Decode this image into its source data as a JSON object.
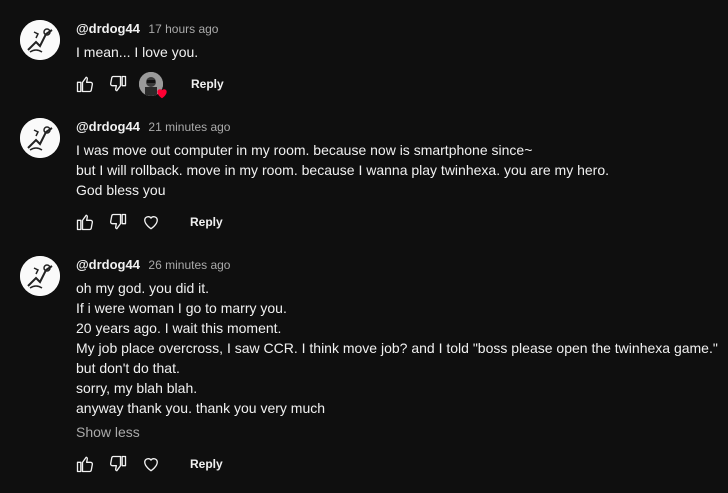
{
  "comments": [
    {
      "author": "@drdog44",
      "time": "17 hours ago",
      "lines": [
        "I mean... I love you."
      ],
      "reply_label": "Reply",
      "hearted": true
    },
    {
      "author": "@drdog44",
      "time": "21 minutes ago",
      "lines": [
        "I was move out computer in my room. because now is smartphone since~",
        "but I will rollback. move in my room. because I wanna play twinhexa. you are my hero.",
        "God bless you"
      ],
      "reply_label": "Reply",
      "hearted": false
    },
    {
      "author": "@drdog44",
      "time": "26 minutes ago",
      "lines": [
        "oh my god. you did it.",
        "If i were woman I go to marry you.",
        "20 years ago. I wait this moment.",
        "My job place overcross, I saw CCR. I think move job? and I told \"boss please open the twinhexa game.\"",
        "but don't do that.",
        "sorry, my blah blah.",
        "anyway thank you. thank you very much"
      ],
      "show_less_label": "Show less",
      "reply_label": "Reply",
      "hearted": false
    }
  ],
  "icons": {
    "like": "thumbs-up-icon",
    "dislike": "thumbs-down-icon",
    "heart": "heart-icon",
    "creator_heart": "creator-heart-badge"
  },
  "colors": {
    "background": "#0f0f0f",
    "text": "#f1f1f1",
    "secondary": "#aaaaaa",
    "heart": "#ff0033"
  }
}
